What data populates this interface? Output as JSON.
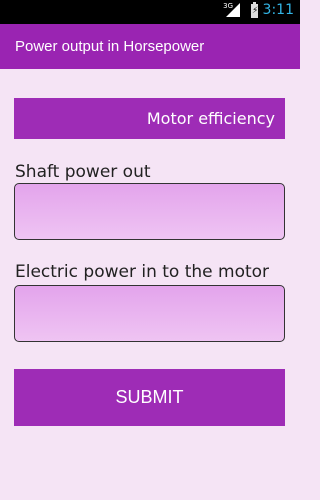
{
  "status_bar": {
    "network": "3G",
    "time": "3:11",
    "time_color": "#33b5e5"
  },
  "action_bar": {
    "title": "Power output in Horsepower",
    "color": "#9a24b2"
  },
  "efficiency_button": {
    "label": "Motor efficiency"
  },
  "fields": {
    "shaft": {
      "label": "Shaft power out",
      "value": ""
    },
    "electric": {
      "label": "Electric power in to the motor",
      "value": ""
    }
  },
  "submit_button": {
    "label": "SUBMIT"
  },
  "colors": {
    "background": "#f5e4f5",
    "accent": "#9e2cb6",
    "field_fill": "#e3a4ec"
  }
}
